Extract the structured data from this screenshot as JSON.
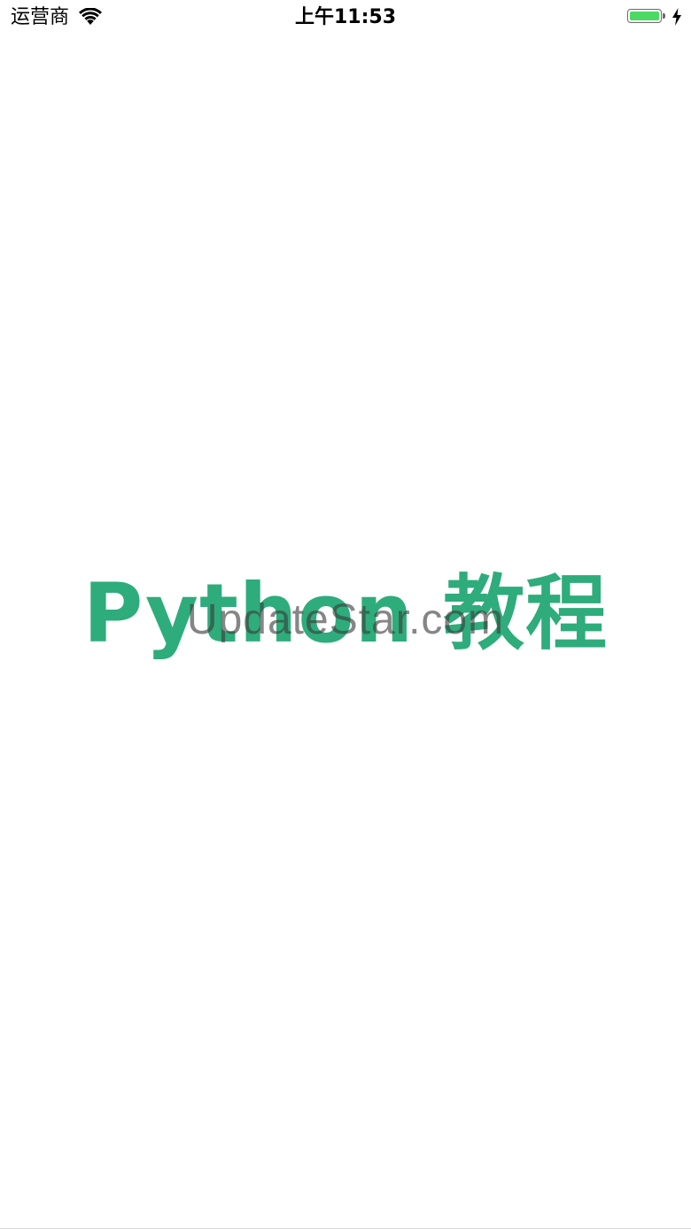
{
  "status_bar": {
    "carrier": "运营商",
    "time": "上午11:53",
    "battery_level": 1.0,
    "charging": true,
    "wifi_icon": "wifi-icon",
    "battery_icon": "battery-icon",
    "charging_icon": "charging-bolt-icon",
    "battery_color": "#4cd964"
  },
  "splash": {
    "title": "Python 教程",
    "title_color": "#2eac7c"
  },
  "watermark": {
    "text": "UpdateStar.com"
  }
}
